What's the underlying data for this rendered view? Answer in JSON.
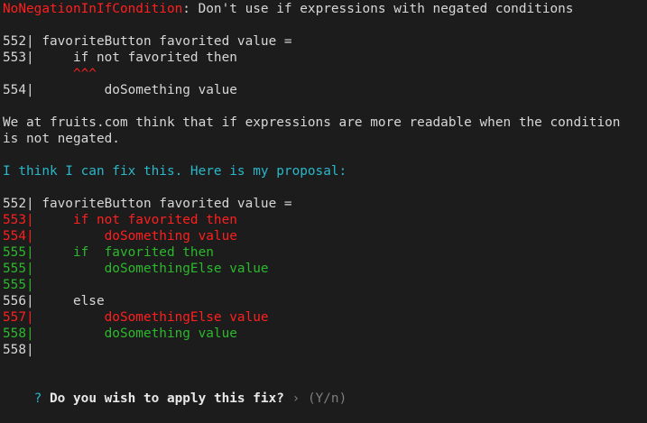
{
  "terminal": {
    "lines": [
      {
        "segments": [
          {
            "text": "NoNegationInIfCondition",
            "color": "#ff1f1f"
          },
          {
            "text": ": Don't use if expressions with negated conditions",
            "color": "#d7d7d7"
          }
        ]
      },
      {
        "segments": []
      },
      {
        "segments": [
          {
            "text": "552| favoriteButton favorited value =",
            "color": "#d7d7d7"
          }
        ]
      },
      {
        "segments": [
          {
            "text": "553|     if not favorited then",
            "color": "#d7d7d7"
          }
        ]
      },
      {
        "segments": [
          {
            "text": "         ^^^",
            "color": "#ff1f1f"
          }
        ]
      },
      {
        "segments": [
          {
            "text": "554|         doSomething value",
            "color": "#d7d7d7"
          }
        ]
      },
      {
        "segments": []
      },
      {
        "segments": [
          {
            "text": "We at fruits.com think that if expressions are more readable when the condition",
            "color": "#d7d7d7"
          }
        ]
      },
      {
        "segments": [
          {
            "text": "is not negated.",
            "color": "#d7d7d7"
          }
        ]
      },
      {
        "segments": []
      },
      {
        "segments": [
          {
            "text": "I think I can fix this. Here is my proposal:",
            "color": "#2ab7c9"
          }
        ]
      },
      {
        "segments": []
      },
      {
        "segments": [
          {
            "text": "552| favoriteButton favorited value =",
            "color": "#d7d7d7"
          }
        ]
      },
      {
        "segments": [
          {
            "text": "553|     if not favorited then",
            "color": "#ff1f1f"
          }
        ]
      },
      {
        "segments": [
          {
            "text": "554|         doSomething value",
            "color": "#ff1f1f"
          }
        ]
      },
      {
        "segments": [
          {
            "text": "555|     if  favorited then",
            "color": "#2cb82c"
          }
        ]
      },
      {
        "segments": [
          {
            "text": "555|         doSomethingElse value",
            "color": "#2cb82c"
          }
        ]
      },
      {
        "segments": [
          {
            "text": "555|",
            "color": "#2cb82c"
          }
        ]
      },
      {
        "segments": [
          {
            "text": "556|     else",
            "color": "#d7d7d7"
          }
        ]
      },
      {
        "segments": [
          {
            "text": "557|         doSomethingElse value",
            "color": "#ff1f1f"
          }
        ]
      },
      {
        "segments": [
          {
            "text": "558|         doSomething value",
            "color": "#2cb82c"
          }
        ]
      },
      {
        "segments": [
          {
            "text": "558|",
            "color": "#d7d7d7"
          }
        ]
      },
      {
        "segments": []
      }
    ],
    "prompt": {
      "question_mark": "?",
      "question": "Do you wish to apply this fix?",
      "arrow": "›",
      "choices": "(Y/n)"
    },
    "colors": {
      "background": "#1c1c1c",
      "default_text": "#d7d7d7",
      "error_red": "#ff1f1f",
      "added_green": "#2cb82c",
      "info_cyan": "#2ab7c9",
      "hint_grey": "#7e7e7e"
    }
  }
}
